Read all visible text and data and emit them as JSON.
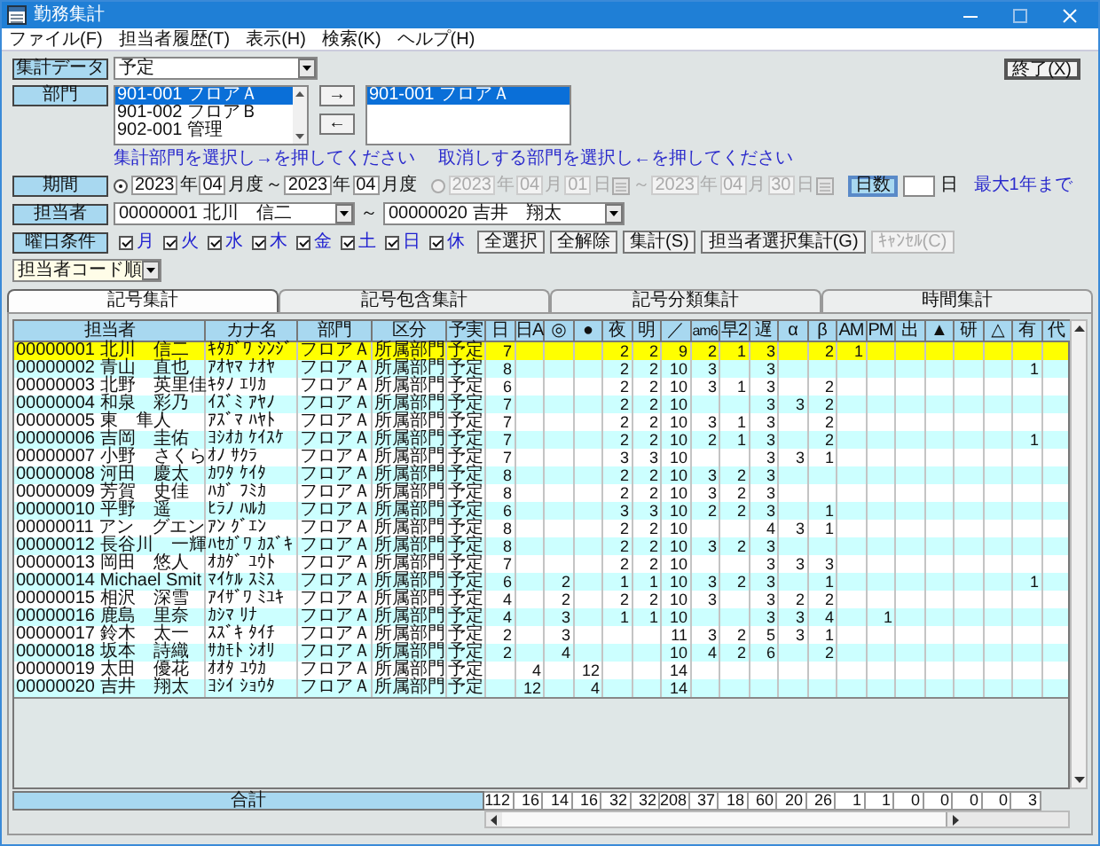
{
  "window": {
    "title": "勤務集計"
  },
  "menu": [
    "ファイル(F)",
    "担当者履歴(T)",
    "表示(H)",
    "検索(K)",
    "ヘルプ(H)"
  ],
  "exit_button": "終了(X)",
  "data_type": {
    "label": "集計データ",
    "value": "予定"
  },
  "department": {
    "label": "部門",
    "available": [
      {
        "text": "901-001 フロアＡ",
        "selected": true
      },
      {
        "text": "901-002 フロアＢ",
        "selected": false
      },
      {
        "text": "902-001 管理",
        "selected": false
      }
    ],
    "add_button": "→",
    "remove_button": "←",
    "chosen": [
      {
        "text": "901-001 フロアＡ",
        "selected": true
      }
    ],
    "add_hint": "集計部門を選択し→を押してください",
    "remove_hint": "取消しする部門を選択し←を押してください"
  },
  "period": {
    "label": "期間",
    "month_range": {
      "selected": true,
      "disabled": false,
      "parts": [
        {
          "kind": "field",
          "text": "2023"
        },
        {
          "kind": "text",
          "text": "年"
        },
        {
          "kind": "field",
          "text": "04"
        },
        {
          "kind": "text",
          "text": "月度"
        },
        {
          "kind": "text",
          "text": "～"
        },
        {
          "kind": "field",
          "text": "2023"
        },
        {
          "kind": "text",
          "text": "年"
        },
        {
          "kind": "field",
          "text": "04"
        },
        {
          "kind": "text",
          "text": "月度"
        }
      ]
    },
    "date_range": {
      "selected": false,
      "disabled": true,
      "parts": [
        {
          "kind": "field",
          "text": "2023"
        },
        {
          "kind": "text",
          "text": "年"
        },
        {
          "kind": "field",
          "text": "04"
        },
        {
          "kind": "text",
          "text": "月"
        },
        {
          "kind": "field",
          "text": "01"
        },
        {
          "kind": "text",
          "text": "日"
        },
        {
          "kind": "calendar"
        },
        {
          "kind": "text",
          "text": "～"
        },
        {
          "kind": "field",
          "text": "2023"
        },
        {
          "kind": "text",
          "text": "年"
        },
        {
          "kind": "field",
          "text": "04"
        },
        {
          "kind": "text",
          "text": "月"
        },
        {
          "kind": "field",
          "text": "30"
        },
        {
          "kind": "text",
          "text": "日"
        },
        {
          "kind": "calendar"
        }
      ]
    },
    "days_button": "日数",
    "days_unit": "日",
    "days_note": "最大1年まで"
  },
  "staff": {
    "label": "担当者",
    "from": "00000001 北川　信二",
    "separator": "～",
    "to": "00000020 吉井　翔太"
  },
  "weekdays": {
    "label": "曜日条件",
    "days": [
      {
        "text": "月",
        "checked": true
      },
      {
        "text": "火",
        "checked": true
      },
      {
        "text": "水",
        "checked": true
      },
      {
        "text": "木",
        "checked": true
      },
      {
        "text": "金",
        "checked": true
      },
      {
        "text": "土",
        "checked": true
      },
      {
        "text": "日",
        "checked": true
      },
      {
        "text": "休",
        "checked": true
      }
    ]
  },
  "buttons": [
    {
      "text": "全選択",
      "disabled": false
    },
    {
      "text": "全解除",
      "disabled": false
    },
    {
      "text": "集計(S)",
      "disabled": false
    },
    {
      "text": "担当者選択集計(G)",
      "disabled": false
    },
    {
      "text": "ｷｬﾝｾﾙ(C)",
      "disabled": true
    }
  ],
  "sort": {
    "value": "担当者コード順"
  },
  "tabs": [
    {
      "label": "記号集計",
      "selected": true
    },
    {
      "label": "記号包含集計",
      "selected": false
    },
    {
      "label": "記号分類集計",
      "selected": false
    },
    {
      "label": "時間集計",
      "selected": false
    }
  ],
  "table": {
    "columns": [
      "担当者",
      "カナ名",
      "部門",
      "区分",
      "予実",
      "日",
      "日A",
      "◎",
      "●",
      "夜",
      "明",
      "／",
      "am6",
      "早2",
      "遅",
      "α",
      "β",
      "AM",
      "PM",
      "出",
      "▲",
      "研",
      "△",
      "有",
      "代"
    ],
    "rows": [
      {
        "selected": true,
        "cells": [
          "00000001 北川　信二",
          "ｷﾀｶﾞﾜ ｼﾝｼﾞ",
          "フロアＡ",
          "所属部門",
          "予定",
          "7",
          null,
          null,
          null,
          "2",
          "2",
          "9",
          "2",
          "1",
          "3",
          null,
          "2",
          "1",
          null,
          null,
          null,
          null,
          null,
          null,
          null
        ]
      },
      {
        "selected": false,
        "cells": [
          "00000002 青山　直也",
          "ｱｵﾔﾏ ﾅｵﾔ",
          "フロアＡ",
          "所属部門",
          "予定",
          "8",
          null,
          null,
          null,
          "2",
          "2",
          "10",
          "3",
          null,
          "3",
          null,
          null,
          null,
          null,
          null,
          null,
          null,
          null,
          "1",
          null
        ]
      },
      {
        "selected": false,
        "cells": [
          "00000003 北野　英里佳",
          "ｷﾀﾉ ｴﾘｶ",
          "フロアＡ",
          "所属部門",
          "予定",
          "6",
          null,
          null,
          null,
          "2",
          "2",
          "10",
          "3",
          "1",
          "3",
          null,
          "2",
          null,
          null,
          null,
          null,
          null,
          null,
          null,
          null
        ]
      },
      {
        "selected": false,
        "cells": [
          "00000004 和泉　彩乃",
          "ｲｽﾞﾐ ｱﾔﾉ",
          "フロアＡ",
          "所属部門",
          "予定",
          "7",
          null,
          null,
          null,
          "2",
          "2",
          "10",
          null,
          null,
          "3",
          "3",
          "2",
          null,
          null,
          null,
          null,
          null,
          null,
          null,
          null
        ]
      },
      {
        "selected": false,
        "cells": [
          "00000005 東　隼人",
          "ｱｽﾞﾏ ﾊﾔﾄ",
          "フロアＡ",
          "所属部門",
          "予定",
          "7",
          null,
          null,
          null,
          "2",
          "2",
          "10",
          "3",
          "1",
          "3",
          null,
          "2",
          null,
          null,
          null,
          null,
          null,
          null,
          null,
          null
        ]
      },
      {
        "selected": false,
        "cells": [
          "00000006 吉岡　圭佑",
          "ﾖｼｵｶ ｹｲｽｹ",
          "フロアＡ",
          "所属部門",
          "予定",
          "7",
          null,
          null,
          null,
          "2",
          "2",
          "10",
          "2",
          "1",
          "3",
          null,
          "2",
          null,
          null,
          null,
          null,
          null,
          null,
          "1",
          null
        ]
      },
      {
        "selected": false,
        "cells": [
          "00000007 小野　さくら",
          "ｵﾉ ｻｸﾗ",
          "フロアＡ",
          "所属部門",
          "予定",
          "7",
          null,
          null,
          null,
          "3",
          "3",
          "10",
          null,
          null,
          "3",
          "3",
          "1",
          null,
          null,
          null,
          null,
          null,
          null,
          null,
          null
        ]
      },
      {
        "selected": false,
        "cells": [
          "00000008 河田　慶太",
          "ｶﾜﾀ ｹｲﾀ",
          "フロアＡ",
          "所属部門",
          "予定",
          "8",
          null,
          null,
          null,
          "2",
          "2",
          "10",
          "3",
          "2",
          "3",
          null,
          null,
          null,
          null,
          null,
          null,
          null,
          null,
          null,
          null
        ]
      },
      {
        "selected": false,
        "cells": [
          "00000009 芳賀　史佳",
          "ﾊｶﾞ ﾌﾐｶ",
          "フロアＡ",
          "所属部門",
          "予定",
          "8",
          null,
          null,
          null,
          "2",
          "2",
          "10",
          "3",
          "2",
          "3",
          null,
          null,
          null,
          null,
          null,
          null,
          null,
          null,
          null,
          null
        ]
      },
      {
        "selected": false,
        "cells": [
          "00000010 平野　遥",
          "ﾋﾗﾉ ﾊﾙｶ",
          "フロアＡ",
          "所属部門",
          "予定",
          "6",
          null,
          null,
          null,
          "3",
          "3",
          "10",
          "2",
          "2",
          "3",
          null,
          "1",
          null,
          null,
          null,
          null,
          null,
          null,
          null,
          null
        ]
      },
      {
        "selected": false,
        "cells": [
          "00000011 アン　グエン",
          "ｱﾝ ｸﾞｴﾝ",
          "フロアＡ",
          "所属部門",
          "予定",
          "8",
          null,
          null,
          null,
          "2",
          "2",
          "10",
          null,
          null,
          "4",
          "3",
          "1",
          null,
          null,
          null,
          null,
          null,
          null,
          null,
          null
        ]
      },
      {
        "selected": false,
        "cells": [
          "00000012 長谷川　一輝",
          "ﾊｾｶﾞﾜ ｶｽﾞｷ",
          "フロアＡ",
          "所属部門",
          "予定",
          "8",
          null,
          null,
          null,
          "2",
          "2",
          "10",
          "3",
          "2",
          "3",
          null,
          null,
          null,
          null,
          null,
          null,
          null,
          null,
          null,
          null
        ]
      },
      {
        "selected": false,
        "cells": [
          "00000013 岡田　悠人",
          "ｵｶﾀﾞ ﾕｳﾄ",
          "フロアＡ",
          "所属部門",
          "予定",
          "7",
          null,
          null,
          null,
          "2",
          "2",
          "10",
          null,
          null,
          "3",
          "3",
          "3",
          null,
          null,
          null,
          null,
          null,
          null,
          null,
          null
        ]
      },
      {
        "selected": false,
        "cells": [
          "00000014 Michael Smit",
          "ﾏｲｹﾙ ｽﾐｽ",
          "フロアＡ",
          "所属部門",
          "予定",
          "6",
          null,
          "2",
          null,
          "1",
          "1",
          "10",
          "3",
          "2",
          "3",
          null,
          "1",
          null,
          null,
          null,
          null,
          null,
          null,
          "1",
          null
        ]
      },
      {
        "selected": false,
        "cells": [
          "00000015 相沢　深雪",
          "ｱｲｻﾞﾜ ﾐﾕｷ",
          "フロアＡ",
          "所属部門",
          "予定",
          "4",
          null,
          "2",
          null,
          "2",
          "2",
          "10",
          "3",
          null,
          "3",
          "2",
          "2",
          null,
          null,
          null,
          null,
          null,
          null,
          null,
          null
        ]
      },
      {
        "selected": false,
        "cells": [
          "00000016 鹿島　里奈",
          "ｶｼﾏ ﾘﾅ",
          "フロアＡ",
          "所属部門",
          "予定",
          "4",
          null,
          "3",
          null,
          "1",
          "1",
          "10",
          null,
          null,
          "3",
          "3",
          "4",
          null,
          "1",
          null,
          null,
          null,
          null,
          null,
          null
        ]
      },
      {
        "selected": false,
        "cells": [
          "00000017 鈴木　太一",
          "ｽｽﾞｷ ﾀｲﾁ",
          "フロアＡ",
          "所属部門",
          "予定",
          "2",
          null,
          "3",
          null,
          null,
          null,
          "11",
          "3",
          "2",
          "5",
          "3",
          "1",
          null,
          null,
          null,
          null,
          null,
          null,
          null,
          null
        ]
      },
      {
        "selected": false,
        "cells": [
          "00000018 坂本　詩織",
          "ｻｶﾓﾄ ｼｵﾘ",
          "フロアＡ",
          "所属部門",
          "予定",
          "2",
          null,
          "4",
          null,
          null,
          null,
          "10",
          "4",
          "2",
          "6",
          null,
          "2",
          null,
          null,
          null,
          null,
          null,
          null,
          null,
          null
        ]
      },
      {
        "selected": false,
        "cells": [
          "00000019 太田　優花",
          "ｵｵﾀ ﾕｳｶ",
          "フロアＡ",
          "所属部門",
          "予定",
          null,
          "4",
          null,
          "12",
          null,
          null,
          "14",
          null,
          null,
          null,
          null,
          null,
          null,
          null,
          null,
          null,
          null,
          null,
          null,
          null
        ]
      },
      {
        "selected": false,
        "cells": [
          "00000020 吉井　翔太",
          "ﾖｼｲ ｼｮｳﾀ",
          "フロアＡ",
          "所属部門",
          "予定",
          null,
          "12",
          null,
          "4",
          null,
          null,
          "14",
          null,
          null,
          null,
          null,
          null,
          null,
          null,
          null,
          null,
          null,
          null,
          null,
          null
        ]
      }
    ],
    "total_label": "合計",
    "totals": [
      "112",
      "16",
      "14",
      "16",
      "32",
      "32",
      "208",
      "37",
      "18",
      "60",
      "20",
      "26",
      "1",
      "1",
      "0",
      "0",
      "0",
      "0",
      "3"
    ]
  }
}
